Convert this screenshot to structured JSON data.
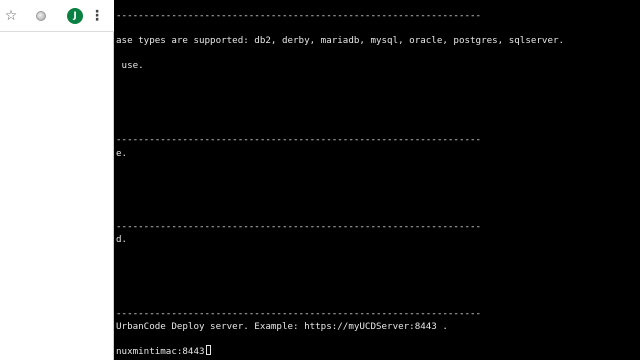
{
  "browser": {
    "toolbar": {
      "star_icon": "☆",
      "avatar_letter": "J",
      "menu_icon": "⋮"
    }
  },
  "terminal": {
    "lines": [
      "------------------------------------------------------------------",
      "ase types are supported: db2, derby, mariadb, mysql, oracle, postgres, sqlserver.",
      " use.",
      "------------------------------------------------------------------",
      "e.",
      "------------------------------------------------------------------",
      "d.",
      "------------------------------------------------------------------",
      "UrbanCode Deploy server. Example: https://myUCDServer:8443 .",
      "nuxmintimac:8443"
    ]
  },
  "colors": {
    "terminal_bg": "#000000",
    "terminal_fg": "#e6e6e6",
    "avatar_bg": "#0b8043"
  }
}
